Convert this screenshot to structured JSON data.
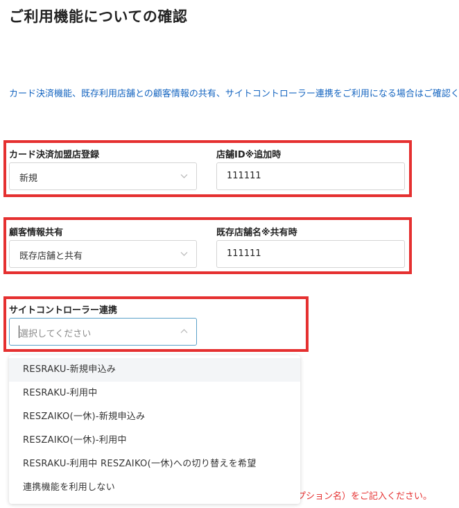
{
  "page": {
    "title": "ご利用機能についての確認",
    "intro": "カード決済機能、既存利用店舗との顧客情報の共有、サイトコントローラー連携をご利用になる場合はご確認ください。"
  },
  "card_payment": {
    "label": "カード決済加盟店登録",
    "selected": "新規"
  },
  "store_id": {
    "label": "店舗ID※追加時",
    "value": "111111"
  },
  "customer_sharing": {
    "label": "顧客情報共有",
    "selected": "既存店舗と共有"
  },
  "existing_store": {
    "label": "既存店舗名※共有時",
    "value": "111111"
  },
  "site_controller": {
    "label": "サイトコントローラー連携",
    "placeholder": "選択してください",
    "options": [
      "RESRAKU-新規申込み",
      "RESRAKU-利用中",
      "RESZAIKO(一休)-新規申込み",
      "RESZAIKO(一休)-利用中",
      "RESRAKU-利用中 RESZAIKO(一休)への切り替えを希望",
      "連携機能を利用しない"
    ]
  },
  "note": {
    "text_tail": "プション名）をご記入ください。"
  },
  "colors": {
    "highlight_border": "#e53030",
    "link_blue": "#1565c0",
    "focus_border": "#5aa0c8"
  }
}
